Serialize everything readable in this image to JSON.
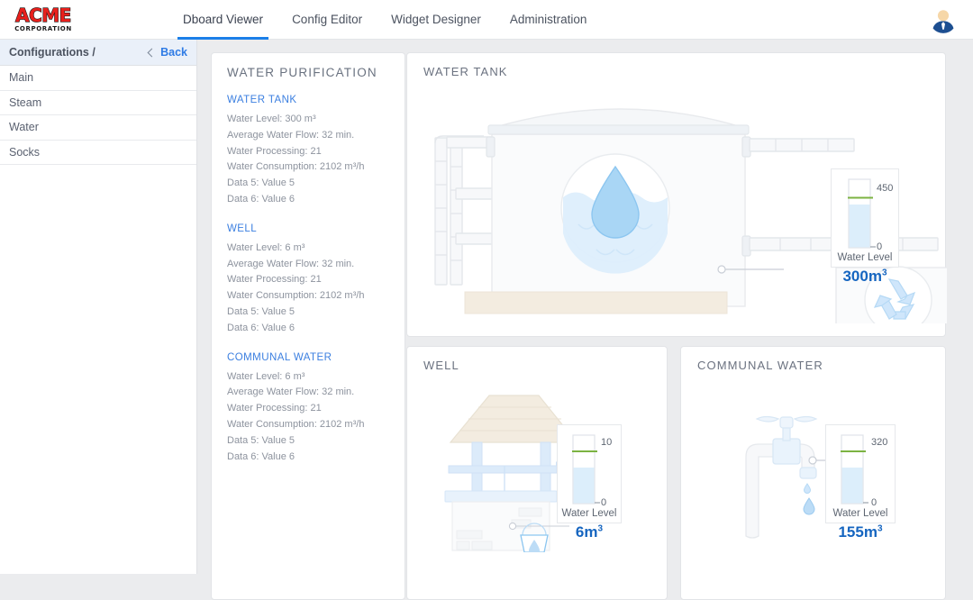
{
  "brand": {
    "word": "ACME",
    "sub": "CORPORATION",
    "word_color": "#e8201c"
  },
  "nav": {
    "items": [
      {
        "label": "Dboard Viewer",
        "active": true
      },
      {
        "label": "Config Editor",
        "active": false
      },
      {
        "label": "Widget Designer",
        "active": false
      },
      {
        "label": "Administration",
        "active": false
      }
    ],
    "accent_color": "#1b7fe8",
    "avatar_icon": "user-avatar-icon"
  },
  "sidebar": {
    "title": "Configurations /",
    "back_label": "Back",
    "back_icon": "chevron-left-icon",
    "items": [
      {
        "label": "Main"
      },
      {
        "label": "Steam"
      },
      {
        "label": "Water"
      },
      {
        "label": "Socks"
      }
    ]
  },
  "info_panel": {
    "title": "WATER PURIFICATION",
    "groups": [
      {
        "title": "WATER TANK",
        "lines": [
          "Water Level: 300 m³",
          "Average Water Flow: 32 min.",
          "Water Processing: 21",
          "Water Consumption: 2102 m³/h",
          "Data 5: Value 5",
          "Data 6: Value 6"
        ]
      },
      {
        "title": "WELL",
        "lines": [
          "Water Level: 6 m³",
          "Average Water Flow: 32 min.",
          "Water Processing: 21",
          "Water Consumption: 2102 m³/h",
          "Data 5: Value 5",
          "Data 6: Value 6"
        ]
      },
      {
        "title": "COMMUNAL WATER",
        "lines": [
          "Water Level: 6 m³",
          "Average Water Flow: 32 min.",
          "Water Processing: 21",
          "Water Consumption: 2102 m³/h",
          "Data 5: Value 5",
          "Data 6: Value 6"
        ]
      }
    ]
  },
  "widgets": {
    "tank": {
      "title": "WATER TANK",
      "illustration": "water-tank-illustration",
      "gauge": {
        "label": "Water Level",
        "value": "300m",
        "unit_exp": "3",
        "max_tick": "450",
        "min_tick": "0",
        "fill_percent": 62,
        "threshold_percent": 72,
        "fill_color": "#dceefb",
        "threshold_color": "#7cb342",
        "value_color": "#1565c0"
      }
    },
    "well": {
      "title": "WELL",
      "illustration": "well-illustration",
      "gauge": {
        "label": "Water Level",
        "value": "6m",
        "unit_exp": "3",
        "max_tick": "10",
        "min_tick": "0",
        "fill_percent": 53,
        "threshold_percent": 75,
        "fill_color": "#dceefb",
        "threshold_color": "#7cb342",
        "value_color": "#1565c0"
      }
    },
    "communal": {
      "title": "COMMUNAL WATER",
      "illustration": "faucet-illustration",
      "gauge": {
        "label": "Water Level",
        "value": "155m",
        "unit_exp": "3",
        "max_tick": "320",
        "min_tick": "0",
        "fill_percent": 53,
        "threshold_percent": 75,
        "fill_color": "#dceefb",
        "threshold_color": "#7cb342",
        "value_color": "#1565c0"
      }
    }
  }
}
